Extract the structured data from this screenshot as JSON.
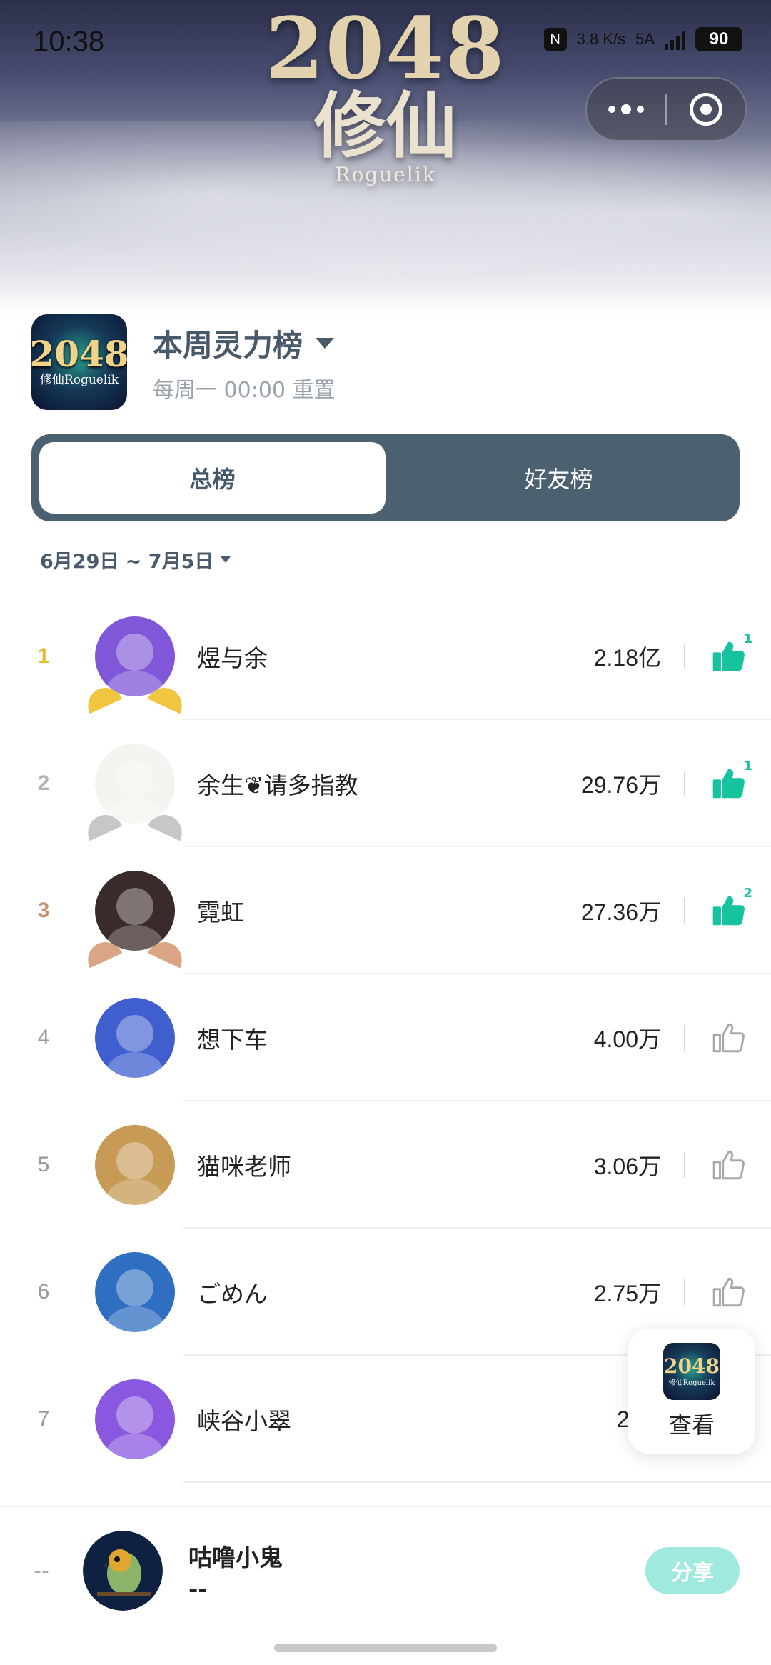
{
  "status_bar": {
    "time": "10:38",
    "nfc": "N",
    "speed": "3.8 K/s",
    "network": "5A",
    "battery": "90"
  },
  "banner": {
    "title_number": "2048",
    "title_cn": "修仙",
    "subtitle": "Roguelik"
  },
  "header": {
    "app_icon_number": "2048",
    "app_icon_text": "修仙Roguelik",
    "title": "本周灵力榜",
    "reset_note": "每周一 00:00 重置"
  },
  "tabs": [
    {
      "label": "总榜",
      "active": true
    },
    {
      "label": "好友榜",
      "active": false
    }
  ],
  "date_range": "6月29日 ~ 7月5日",
  "rankings": [
    {
      "rank": "1",
      "name": "煜与余",
      "score": "2.18亿",
      "likes": "1",
      "liked": true,
      "avatar_color": "#7f57d8",
      "medal": "gold"
    },
    {
      "rank": "2",
      "name": "余生❦请多指教",
      "score": "29.76万",
      "likes": "1",
      "liked": true,
      "avatar_color": "#f2f5ef",
      "medal": "silver"
    },
    {
      "rank": "3",
      "name": "霓虹",
      "score": "27.36万",
      "likes": "2",
      "liked": true,
      "avatar_color": "#3a2a2a",
      "medal": "bronze"
    },
    {
      "rank": "4",
      "name": "想下车",
      "score": "4.00万",
      "likes": "",
      "liked": false,
      "avatar_color": "#3f5fcf",
      "medal": ""
    },
    {
      "rank": "5",
      "name": "猫咪老师",
      "score": "3.06万",
      "likes": "",
      "liked": false,
      "avatar_color": "#c79a55",
      "medal": ""
    },
    {
      "rank": "6",
      "name": "ごめん",
      "score": "2.75万",
      "likes": "",
      "liked": false,
      "avatar_color": "#2f6fc2",
      "medal": ""
    },
    {
      "rank": "7",
      "name": "峡谷小翠",
      "score": "2.57",
      "likes": "",
      "liked": false,
      "avatar_color": "#8a58e0",
      "medal": ""
    }
  ],
  "floating": {
    "icon_number": "2048",
    "icon_text": "修仙Roguelik",
    "label": "查看"
  },
  "self": {
    "rank": "--",
    "name": "咕噜小鬼",
    "score": "--",
    "share_label": "分享",
    "avatar_color": "#0f2140"
  },
  "colors": {
    "accent": "#17c29f",
    "tab_bg": "#4b6170",
    "header_text": "#48596a",
    "share_bg": "#9fe9de"
  }
}
